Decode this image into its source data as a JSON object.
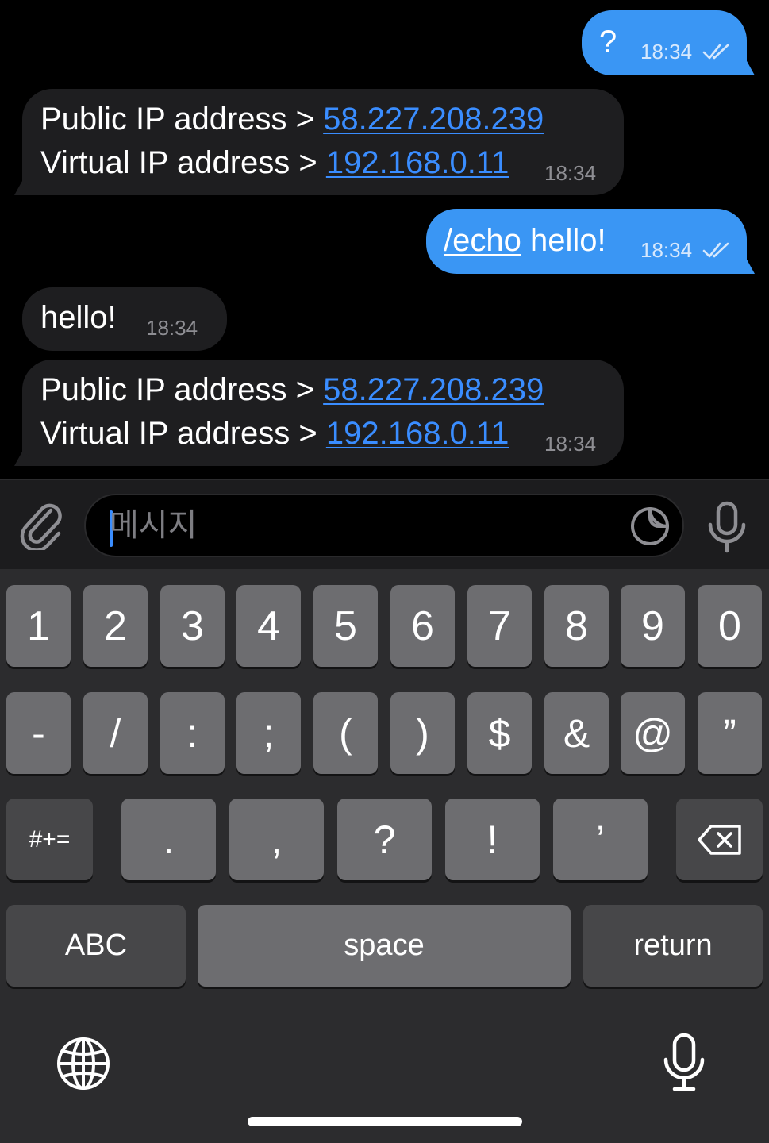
{
  "messages": [
    {
      "direction": "out",
      "text": "?",
      "time": "18:34",
      "status": "read"
    },
    {
      "direction": "in",
      "line1_label": "Public IP address > ",
      "line1_link": "58.227.208.239",
      "line2_label": "Virtual IP address > ",
      "line2_link": "192.168.0.11",
      "time": "18:34"
    },
    {
      "direction": "out",
      "command": "/echo",
      "text": " hello!",
      "time": "18:34",
      "status": "read"
    },
    {
      "direction": "in",
      "text": "hello!",
      "time": "18:34"
    },
    {
      "direction": "in",
      "line1_label": "Public IP address > ",
      "line1_link": "58.227.208.239",
      "line2_label": "Virtual IP address > ",
      "line2_link": "192.168.0.11",
      "time": "18:34"
    }
  ],
  "composer": {
    "placeholder": "메시지",
    "icons": {
      "attach": "paperclip-icon",
      "sticker": "sticker-icon",
      "voice": "microphone-icon"
    }
  },
  "keyboard": {
    "row1": [
      "1",
      "2",
      "3",
      "4",
      "5",
      "6",
      "7",
      "8",
      "9",
      "0"
    ],
    "row2": [
      "-",
      "/",
      ":",
      ";",
      "(",
      ")",
      "$",
      "&",
      "@",
      "”"
    ],
    "row3": {
      "shift": "#+=",
      "keys": [
        ".",
        ",",
        "?",
        "!",
        "’"
      ],
      "backspace": "backspace-icon"
    },
    "row4": {
      "abc": "ABC",
      "space": "space",
      "return": "return"
    },
    "bottom": {
      "globe": "globe-icon",
      "dictation": "microphone-icon"
    }
  },
  "colors": {
    "outgoing_bubble": "#3a96f4",
    "incoming_bubble": "#1e1e20",
    "link": "#3a8dff",
    "keyboard_bg": "#2c2c2e"
  }
}
